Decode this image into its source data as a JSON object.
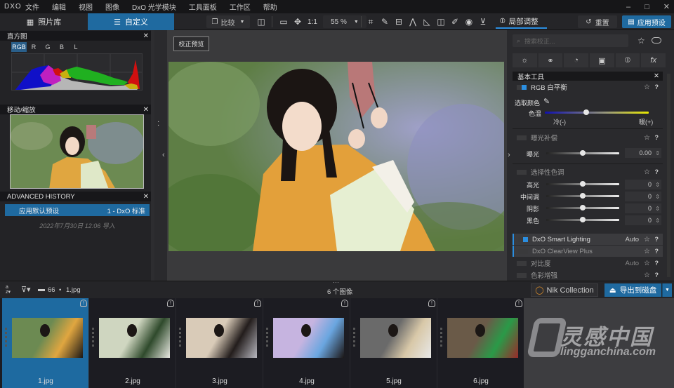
{
  "app": {
    "logo": "DXO"
  },
  "menu": [
    "文件",
    "编辑",
    "视图",
    "图像",
    "DxO 光学模块",
    "工具面板",
    "工作区",
    "帮助"
  ],
  "window_controls": {
    "minimize": "–",
    "maximize": "□",
    "close": "✕"
  },
  "toolbar": {
    "tab_library": "照片库",
    "tab_customize": "自定义",
    "compare": "比较",
    "zoom_fit": "1:1",
    "zoom_level": "55 %",
    "local_adjust": "局部调整",
    "reset": "重置",
    "apply_preset": "应用预设"
  },
  "histogram": {
    "title": "直方图",
    "channels": [
      "RGB",
      "R",
      "G",
      "B",
      "L"
    ],
    "active_channel": "RGB"
  },
  "navigator": {
    "title": "移动/缩放"
  },
  "history": {
    "title": "ADVANCED HISTORY",
    "entries": [
      {
        "action": "应用默认预设",
        "preset": "1 - DxO 标准"
      }
    ],
    "import_note": "2022年7月30日 12:06 导入"
  },
  "viewer": {
    "preview_button": "校正预览"
  },
  "right_panel": {
    "search_placeholder": "搜索校正...",
    "section_title": "基本工具",
    "white_balance": {
      "title": "RGB 白平衡",
      "picker_label": "选取颜色",
      "temp_label": "色温",
      "cold": "冷(-)",
      "warm": "暖(+)",
      "temp_position": 0.4
    },
    "exposure": {
      "title": "曝光补偿",
      "label": "曝光",
      "value": "0.00",
      "position": 0.5
    },
    "selective_tone": {
      "title": "选择性色调",
      "rows": [
        {
          "label": "高光",
          "value": "0"
        },
        {
          "label": "中间调",
          "value": "0"
        },
        {
          "label": "阴影",
          "value": "0"
        },
        {
          "label": "黑色",
          "value": "0"
        }
      ]
    },
    "tools": [
      {
        "name": "DxO Smart Lighting",
        "mode": "Auto",
        "on": true
      },
      {
        "name": "DxO ClearView Plus",
        "mode": "",
        "on": false
      },
      {
        "name": "对比度",
        "mode": "Auto",
        "on": false
      },
      {
        "name": "色彩增强",
        "mode": "",
        "on": false
      }
    ]
  },
  "bottom_bar": {
    "folder": "66",
    "current_file": "1.jpg",
    "image_count": "6 个图像",
    "nik": "Nik Collection",
    "export": "导出到磁盘"
  },
  "filmstrip": [
    {
      "name": "1.jpg",
      "selected": true
    },
    {
      "name": "2.jpg",
      "selected": false
    },
    {
      "name": "3.jpg",
      "selected": false
    },
    {
      "name": "4.jpg",
      "selected": false
    },
    {
      "name": "5.jpg",
      "selected": false
    },
    {
      "name": "6.jpg",
      "selected": false
    }
  ],
  "watermark": {
    "title": "灵感中国",
    "url": "lingganchina.com"
  }
}
